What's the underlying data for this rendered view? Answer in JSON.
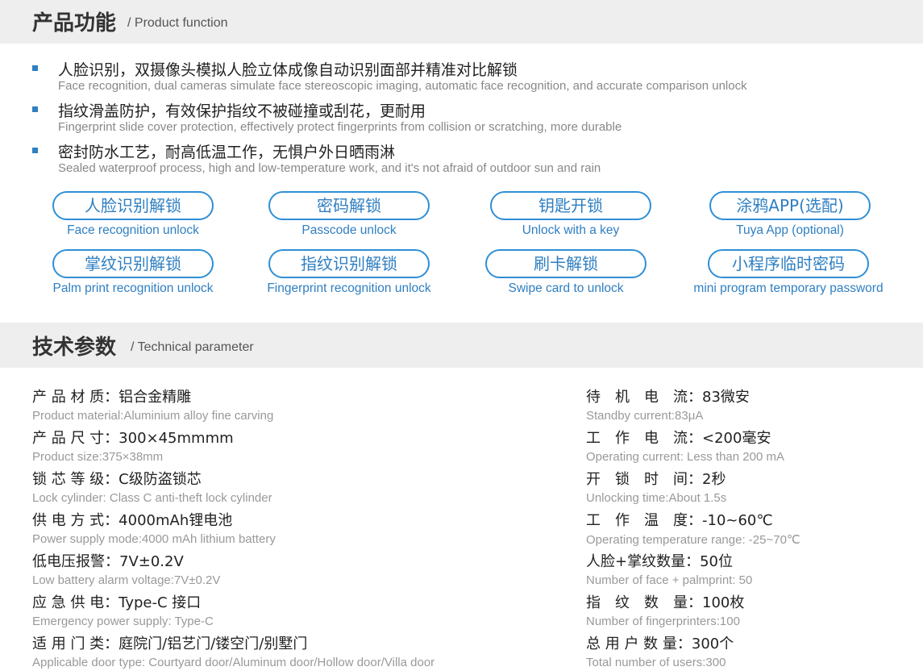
{
  "section1": {
    "title_zh": "产品功能",
    "title_en": "/ Product function"
  },
  "features": [
    {
      "zh": "人脸识别，双摄像头模拟人脸立体成像自动识别面部并精准对比解锁",
      "en": "Face recognition, dual cameras simulate face stereoscopic imaging, automatic face recognition, and accurate comparison unlock"
    },
    {
      "zh": "指纹滑盖防护，有效保护指纹不被碰撞或刮花，更耐用",
      "en": "Fingerprint slide cover protection, effectively protect fingerprints from collision or scratching, more durable"
    },
    {
      "zh": "密封防水工艺，耐高低温工作，无惧户外日晒雨淋",
      "en": "Sealed waterproof process, high and low-temperature work, and it's not afraid of outdoor sun and rain"
    }
  ],
  "unlock_methods": [
    {
      "zh": "人脸识别解锁",
      "en": "Face recognition unlock"
    },
    {
      "zh": "密码解锁",
      "en": "Passcode unlock"
    },
    {
      "zh": "钥匙开锁",
      "en": "Unlock with a key"
    },
    {
      "zh": "涂鸦APP(选配)",
      "en": "Tuya App (optional)"
    },
    {
      "zh": "掌纹识别解锁",
      "en": "Palm print recognition unlock"
    },
    {
      "zh": "指纹识别解锁",
      "en": "Fingerprint recognition unlock"
    },
    {
      "zh": "刷卡解锁",
      "en": "Swipe card to unlock"
    },
    {
      "zh": "小程序临时密码",
      "en": "mini program temporary password"
    }
  ],
  "section2": {
    "title_zh": "技术参数",
    "title_en": "/ Technical parameter"
  },
  "specs_left": [
    {
      "zh": "产 品 材 质：铝合金精雕",
      "en": "Product material:Aluminium alloy fine carving"
    },
    {
      "zh": "产 品 尺 寸：300×45mmmm",
      "en": " Product size:375×38mm"
    },
    {
      "zh": "锁 芯 等 级：C级防盗锁芯",
      "en": " Lock cylinder: Class C anti-theft lock cylinder"
    },
    {
      "zh": "供 电 方 式：4000mAh锂电池",
      "en": "Power supply mode:4000 mAh lithium battery"
    },
    {
      "zh": "低电压报警：7V±0.2V",
      "en": "Low battery alarm voltage:7V±0.2V"
    },
    {
      "zh": "应 急 供 电：Type-C 接口",
      "en": "Emergency power supply:  Type-C"
    },
    {
      "zh": "适 用 门 类：庭院门/铝艺门/镂空门/别墅门",
      "en": "Applicable door type:  Courtyard door/Aluminum door/Hollow door/Villa door"
    }
  ],
  "specs_right": [
    {
      "zh": "待　机　电　流：83微安",
      "en": "Standby current:83μA"
    },
    {
      "zh": "工　作　电　流：<200毫安",
      "en": "Operating current: Less than 200 mA"
    },
    {
      "zh": "开　锁　时　间：2秒",
      "en": "Unlocking time:About 1.5s"
    },
    {
      "zh": "工　作　温　度：-10~60℃",
      "en": "Operating temperature range:  -25~70℃"
    },
    {
      "zh": "人脸+掌纹数量：50位",
      "en": "Number of face + palmprint: 50"
    },
    {
      "zh": "指　纹　数　量：100枚",
      "en": "Number of fingerprinters:100"
    },
    {
      "zh": "总 用 户 数 量：300个",
      "en": "Total number of users:300"
    }
  ],
  "colors": {
    "accent": "#2f7fc1",
    "header_bg": "#eeeeee",
    "muted_text": "#999999"
  }
}
